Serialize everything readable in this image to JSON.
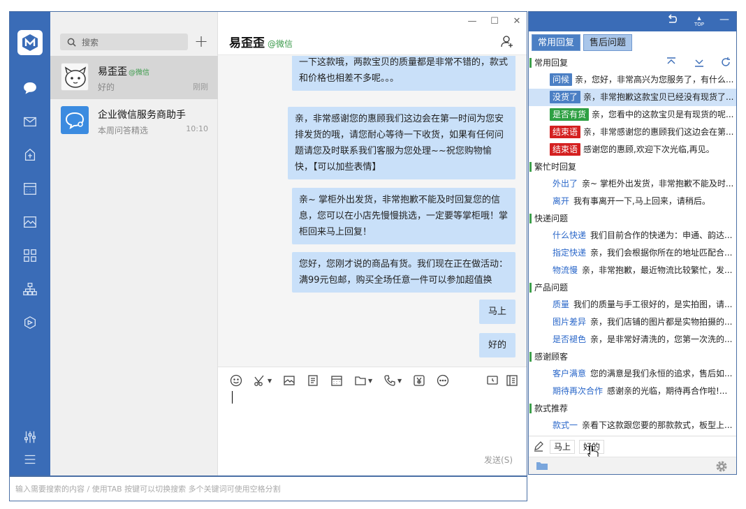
{
  "sidebar": {
    "icons": [
      "logo-icon",
      "chat-icon",
      "mail-icon",
      "doc-icon",
      "calendar-icon",
      "gallery-icon",
      "apps-icon",
      "org-icon",
      "cube-icon",
      "settings-sliders-icon",
      "menu-icon"
    ]
  },
  "conversations": {
    "search_placeholder": "搜索",
    "items": [
      {
        "name": "易歪歪",
        "source": "@微信",
        "preview": "好的",
        "time": "刚刚"
      },
      {
        "name": "企业微信服务商助手",
        "source": "",
        "preview": "本周问答精选",
        "time": "10:10"
      }
    ]
  },
  "chat": {
    "title": "易歪歪",
    "source": "@微信",
    "messages": [
      "一下这款哦，两款宝贝的质量都是非常不错的，款式和价格也相差不多呢。。。",
      "亲，非常感谢您的惠顾我们这边会在第一时间为您安排发货的哦，请您耐心等待一下收货，如果有任何问题请您及时联系我们客服为您处理~~祝您购物愉快，【可以加些表情】",
      "亲~ 掌柜外出发货，非常抱歉不能及时回复您的信息，您可以在小店先慢慢挑选，一定要等掌柜哦！掌柜回来马上回复！",
      "您好，您刚才说的商品有货。我们现在正在做活动：满99元包邮，购买全场任意一件可以参加超值换",
      "马上",
      "好的"
    ],
    "send_label": "发送(S)"
  },
  "bottom_search": {
    "placeholder": "输入需要搜索的内容 / 使用TAB 按键可以切换搜索 多个关键词可使用空格分割"
  },
  "panel": {
    "tabs": [
      "常用回复",
      "售后问题"
    ],
    "sections": [
      {
        "title": "常用回复",
        "items": [
          {
            "tag": "问候",
            "color": "#4b7fc4",
            "text": "亲，您好，非常高兴为您服务了，有什么..."
          },
          {
            "tag": "没货了",
            "color": "#4b7fc4",
            "text": "亲，非常抱歉这款宝贝已经没有现货了..."
          },
          {
            "tag": "是否有货",
            "color": "#2ea043",
            "text": "亲，您看中的这款宝贝是有现货的呢..."
          },
          {
            "tag": "结束语",
            "color": "#d42020",
            "text": "亲，非常感谢您的惠顾我们这边会在第..."
          },
          {
            "tag": "结束语",
            "color": "#d42020",
            "text": "感谢您的惠顾,欢迎下次光临,再见。"
          }
        ]
      },
      {
        "title": "繁忙时回复",
        "items": [
          {
            "link": "外出了",
            "text": "亲~ 掌柜外出发货，非常抱歉不能及时..."
          },
          {
            "link": "离开",
            "text": "我有事离开一下,马上回来，请稍后。"
          }
        ]
      },
      {
        "title": "快递问题",
        "items": [
          {
            "link": "什么快递",
            "text": "我们目前合作的快递为：申通、韵达..."
          },
          {
            "link": "指定快递",
            "text": "亲，我们会根据你所在的地址匹配合..."
          },
          {
            "link": "物流慢",
            "text": "亲，非常抱歉，最近物流比较繁忙，发..."
          }
        ]
      },
      {
        "title": "产品问题",
        "items": [
          {
            "link": "质量",
            "text": "我们的质量与手工很好的，是实拍图，请..."
          },
          {
            "link": "图片差异",
            "text": "亲，我们店铺的图片都是实物拍摄的..."
          },
          {
            "link": "是否褪色",
            "text": "亲，是非常好清洗的，您第一次洗的..."
          }
        ]
      },
      {
        "title": "感谢顾客",
        "items": [
          {
            "link": "客户满意",
            "text": "您的满意是我们永恒的追求，售后如..."
          },
          {
            "link": "期待再次合作",
            "text": "感谢亲的光临，期待再合作啦!..."
          }
        ]
      },
      {
        "title": "款式推荐",
        "items": [
          {
            "link": "款式一",
            "text": "亲看下这款跟您要的那款款式，板型上..."
          }
        ]
      }
    ],
    "recent_chips": [
      "马上",
      "好的"
    ]
  }
}
